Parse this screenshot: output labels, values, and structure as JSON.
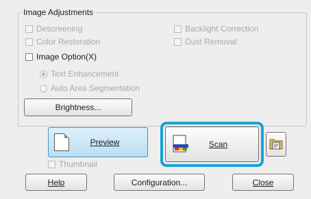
{
  "group": {
    "title": "Image Adjustments"
  },
  "options": {
    "descreening": {
      "label": "Descreening",
      "checked": false,
      "enabled": false
    },
    "backlight": {
      "label": "Backlight Correction",
      "checked": false,
      "enabled": false
    },
    "color_restoration": {
      "label": "Color Restoration",
      "checked": false,
      "enabled": false
    },
    "dust_removal": {
      "label": "Dust Removal",
      "checked": false,
      "enabled": false
    },
    "image_option": {
      "label": "Image Option(X)",
      "checked": false,
      "enabled": true
    },
    "text_enhancement": {
      "label": "Text Enhancement",
      "selected": true,
      "enabled": false
    },
    "auto_area": {
      "label": "Auto Area Segmentation",
      "selected": false,
      "enabled": false
    }
  },
  "buttons": {
    "brightness": "Brightness...",
    "preview": "Preview",
    "scan": "Scan",
    "help": "Help",
    "configuration": "Configuration...",
    "close": "Close"
  },
  "thumbnail": {
    "label": "Thumbnail",
    "checked": false,
    "enabled": false
  },
  "colors": {
    "highlight": "#16a3d6",
    "preview_bg": "#c9e6f7",
    "disabled_text": "#a8a8a8"
  }
}
